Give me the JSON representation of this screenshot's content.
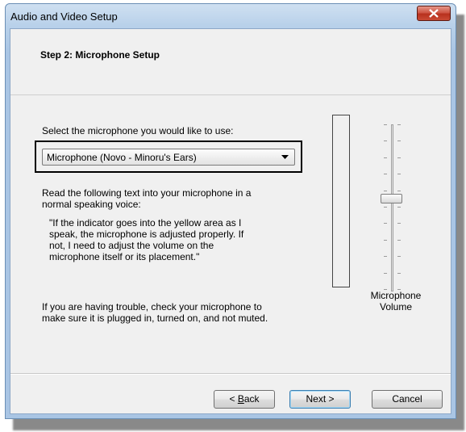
{
  "window": {
    "title": "Audio and Video Setup",
    "close_icon": "close-x-icon"
  },
  "header": {
    "step_title": "Step 2: Microphone Setup"
  },
  "main": {
    "select_prompt": "Select the microphone you would like to use:",
    "microphone_selected": "Microphone (Novo - Minoru's Ears)",
    "read_prompt_line1": "Read the following text into your microphone in a",
    "read_prompt_line2": "normal speaking voice:",
    "quote_line1": "\"If the indicator goes into the yellow area as I",
    "quote_line2": "speak, the microphone is adjusted properly.  If",
    "quote_line3": "not, I need to adjust the volume on the",
    "quote_line4": "microphone itself or its placement.\"",
    "trouble_line1": "If you are having trouble, check your microphone to",
    "trouble_line2": "make sure it is plugged in, turned on, and not muted.",
    "volume_label_line1": "Microphone",
    "volume_label_line2": "Volume",
    "volume_level": 0.55,
    "input_level": 0
  },
  "buttons": {
    "back_prefix": "< ",
    "back_accel": "B",
    "back_rest": "ack",
    "next": "Next >",
    "cancel": "Cancel"
  }
}
